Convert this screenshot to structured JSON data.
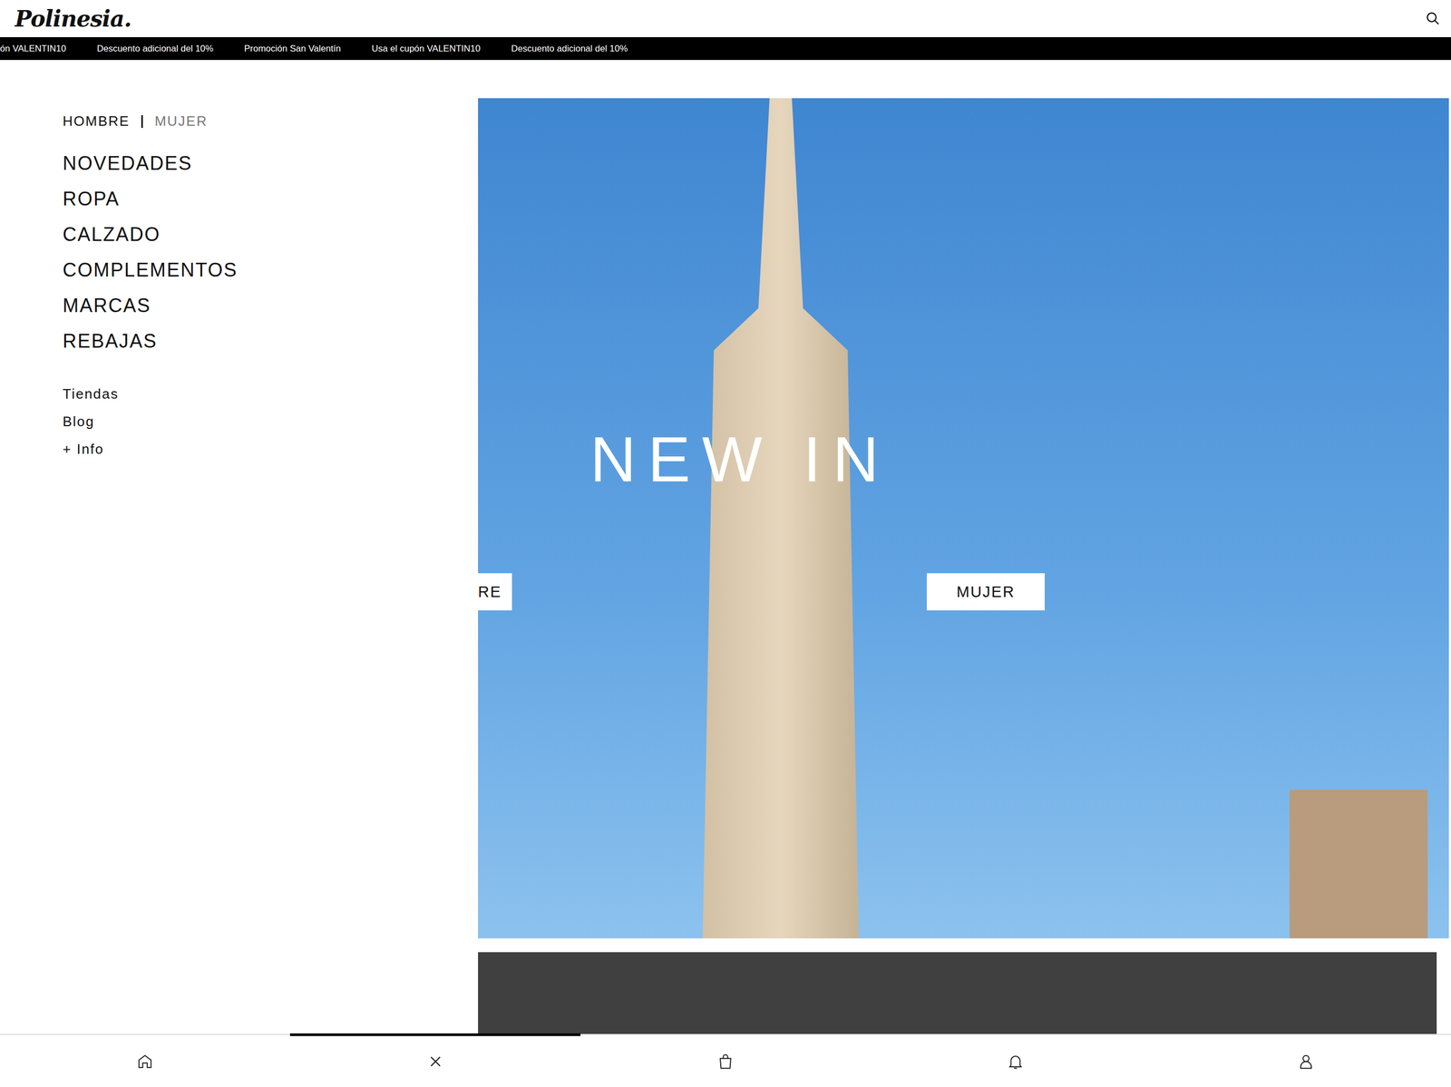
{
  "header": {
    "logo": "Polinesia."
  },
  "promo_strip": [
    "ón VALENTIN10",
    "Descuento adicional del 10%",
    "Promoción San Valentín",
    "Usa el cupón VALENTIN10",
    "Descuento adicional del 10%"
  ],
  "menu": {
    "gender_tabs": [
      {
        "label": "HOMBRE",
        "selected": true
      },
      {
        "label": "MUJER",
        "selected": false
      }
    ],
    "items": [
      "NOVEDADES",
      "ROPA",
      "CALZADO",
      "COMPLEMENTOS",
      "MARCAS",
      "REBAJAS"
    ],
    "links": [
      "Tiendas",
      "Blog",
      "+ Info"
    ]
  },
  "hero": {
    "title": "NEW IN",
    "buttons": [
      "RE",
      "MUJER"
    ]
  },
  "bottom_nav": [
    {
      "kind": "home",
      "selected": false
    },
    {
      "kind": "close",
      "selected": true
    },
    {
      "kind": "bag",
      "selected": false
    },
    {
      "kind": "bell",
      "selected": false
    },
    {
      "kind": "user",
      "selected": false
    }
  ]
}
